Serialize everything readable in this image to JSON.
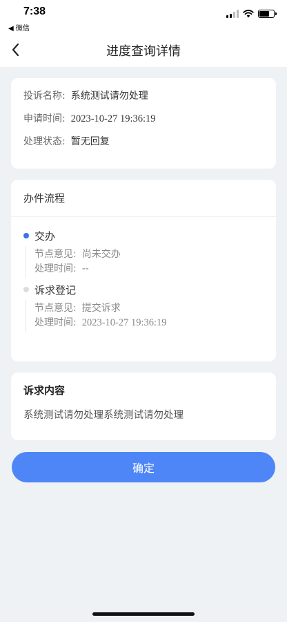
{
  "status_bar": {
    "time": "7:38",
    "back_app": "◀ 微信"
  },
  "nav": {
    "title": "进度查询详情"
  },
  "complaint": {
    "name_label": "投诉名称:",
    "name_value": "系统测试请勿处理",
    "time_label": "申请时间:",
    "time_value": "2023-10-27 19:36:19",
    "status_label": "处理状态:",
    "status_value": "暂无回复"
  },
  "process": {
    "header": "办件流程",
    "nodes": [
      {
        "name": "交办",
        "state": "active",
        "opinion_label": "节点意见:",
        "opinion_value": "尚未交办",
        "time_label": "处理时间:",
        "time_value": "--"
      },
      {
        "name": "诉求登记",
        "state": "inactive",
        "opinion_label": "节点意见:",
        "opinion_value": "提交诉求",
        "time_label": "处理时间:",
        "time_value": "2023-10-27 19:36:19"
      }
    ]
  },
  "content": {
    "title": "诉求内容",
    "text": "系统测试请勿处理系统测试请勿处理"
  },
  "actions": {
    "confirm_label": "确定"
  },
  "colors": {
    "accent": "#4e86f7",
    "active_dot": "#3a73e8",
    "background": "#eef2f5"
  }
}
